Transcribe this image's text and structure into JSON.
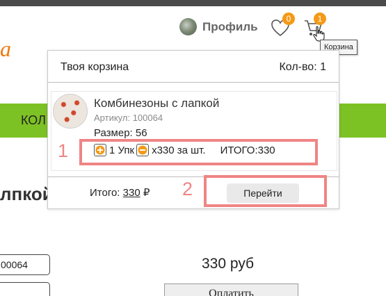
{
  "header": {
    "logo_fragment": "a",
    "profile_label": "Профиль",
    "favorites_count": "0",
    "cart_count": "1",
    "cart_tooltip": "Корзина"
  },
  "background": {
    "nav_fragment": "КОЛ",
    "heading_fragment": "лпкой",
    "field1_value": "00064",
    "field2_value": "",
    "price": "330 руб",
    "pay_button": "Оплатить"
  },
  "cart": {
    "title": "Твоя корзина",
    "qty_label": "Кол-во: 1",
    "item": {
      "name": "Комбинезоны с лапкой",
      "sku": "Артикул: 100064",
      "size": "Размер: 56",
      "qty_unit": "1 Упк",
      "price_each": "х330 за шт.",
      "line_total": "ИТОГО:330"
    },
    "total_label": "Итого:",
    "total_value": "330",
    "currency": "₽",
    "go_button": "Перейти"
  },
  "markers": {
    "one": "1",
    "two": "2"
  },
  "colors": {
    "accent_orange": "#f59a16",
    "green": "#7dc224",
    "marker": "#ef8584"
  }
}
